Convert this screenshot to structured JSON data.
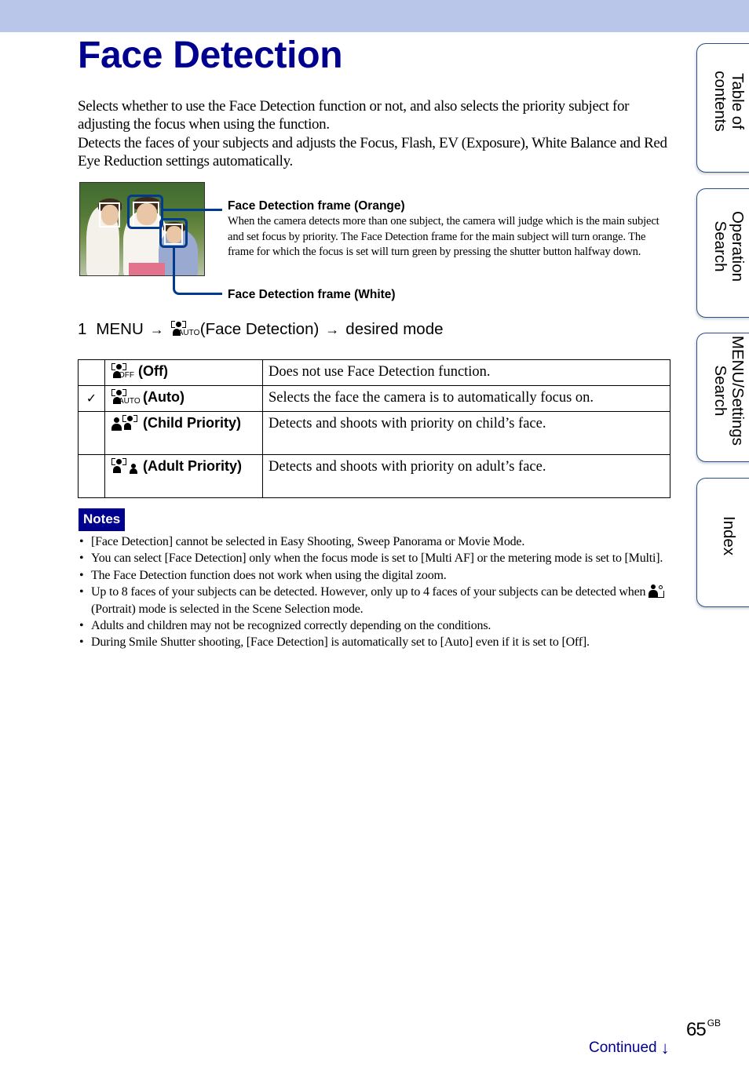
{
  "page": {
    "title": "Face Detection",
    "intro": [
      "Selects whether to use the Face Detection function or not, and also selects the priority subject for adjusting the focus when using the function.",
      "Detects the faces of your subjects and adjusts the Focus, Flash, EV (Exposure), White Balance and Red Eye Reduction settings automatically."
    ]
  },
  "illustration": {
    "callouts": [
      {
        "title": "Face Detection frame (Orange)",
        "body": "When the camera detects more than one subject, the camera will judge which is the main subject and set focus by priority. The Face Detection frame for the main subject will turn orange. The frame for which the focus is set will turn green by pressing the shutter button halfway down."
      },
      {
        "title": "Face Detection frame (White)",
        "body": ""
      }
    ]
  },
  "step": {
    "number": "1",
    "menu": "MENU",
    "arrow": "→",
    "icon": "face-detection-auto-icon",
    "icon_tag": "AUTO",
    "item": "(Face Detection)",
    "target": "desired mode"
  },
  "modes": [
    {
      "icon": "face-detection-off-icon",
      "icon_tag": "OFF",
      "label": "(Off)",
      "description": "Does not use Face Detection function.",
      "selected": false
    },
    {
      "icon": "face-detection-auto-icon",
      "icon_tag": "AUTO",
      "label": "(Auto)",
      "description": "Selects the face the camera is to automatically focus on.",
      "selected": true
    },
    {
      "icon": "child-priority-icon",
      "label": "(Child Priority)",
      "description": "Detects and shoots with priority on child’s face.",
      "selected": false
    },
    {
      "icon": "adult-priority-icon",
      "label": "(Adult Priority)",
      "description": "Detects and shoots with priority on adult’s face.",
      "selected": false
    }
  ],
  "check_mark": "✓",
  "notes": {
    "label": "Notes",
    "items": [
      "[Face Detection] cannot be selected in Easy Shooting, Sweep Panorama or Movie Mode.",
      "You can select [Face Detection] only when the focus mode is set to [Multi AF] or the metering mode is set to [Multi].",
      "The Face Detection function does not work when using the digital zoom.",
      {
        "before": "Up to 8 faces of your subjects can be detected. However, only up to 4 faces of your subjects can be detected when",
        "icon": "portrait-icon",
        "after": "(Portrait) mode is selected in the Scene Selection mode."
      },
      "Adults and children may not be recognized correctly depending on the conditions.",
      "During Smile Shutter shooting, [Face Detection] is automatically set to [Auto] even if it is set to [Off]."
    ]
  },
  "side_tabs": [
    {
      "label_line1": "Table of",
      "label_line2": "contents"
    },
    {
      "label_line1": "Operation",
      "label_line2": "Search"
    },
    {
      "label_line1": "MENU/Settings",
      "label_line2": "Search"
    },
    {
      "label_line1": "Index",
      "label_line2": ""
    }
  ],
  "footer": {
    "page_number": "65",
    "page_suffix": "GB",
    "continued": "Continued",
    "continued_arrow": "↓"
  },
  "colors": {
    "header_bar": "#b9c6ea",
    "title": "#00008f",
    "frame_line": "#003b8e",
    "notes_badge": "#00008f",
    "link": "#00008f"
  }
}
